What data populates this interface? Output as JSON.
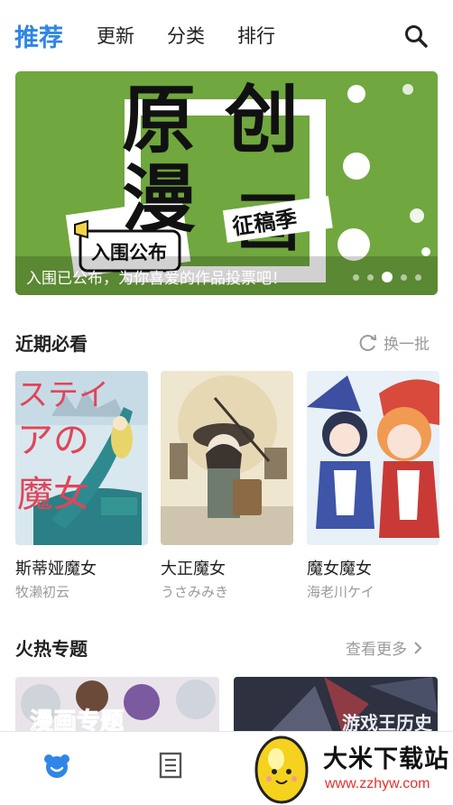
{
  "nav": {
    "tabs": [
      {
        "label": "推荐",
        "active": true
      },
      {
        "label": "更新",
        "active": false
      },
      {
        "label": "分类",
        "active": false
      },
      {
        "label": "排行",
        "active": false
      }
    ],
    "search_icon": "search-icon"
  },
  "banner": {
    "art_text": [
      "原",
      "创",
      "漫",
      "画",
      "征稿季",
      "入围公布"
    ],
    "caption": "入围已公布，为你喜爱的作品投票吧！",
    "slide_count": 5,
    "active_slide": 3
  },
  "recent": {
    "title": "近期必看",
    "action_label": "换一批",
    "action_icon": "refresh-icon",
    "items": [
      {
        "title": "斯蒂娅魔女",
        "author": "牧濑初云",
        "cover_text": [
          "ステイ",
          "アの",
          "魔女"
        ]
      },
      {
        "title": "大正魔女",
        "author": "うさみみき"
      },
      {
        "title": "魔女魔女",
        "author": "海老川ケイ"
      }
    ]
  },
  "hot": {
    "title": "火热专题",
    "action_label": "查看更多",
    "action_icon": "chevron-right-icon",
    "topics": [
      {
        "cover_text": "漫画专题"
      },
      {
        "cover_text": "游戏王历史"
      }
    ]
  },
  "tabbar": {
    "items": [
      {
        "icon": "bear-home-icon",
        "active": true
      },
      {
        "icon": "document-icon",
        "active": false
      }
    ]
  },
  "watermark": {
    "text": "大米下载站",
    "url": "www.zzhyw.com"
  },
  "colors": {
    "accent": "#2f86e6",
    "muted": "#9a9a9a",
    "banner_green": "#6aa23a",
    "watermark_red": "#e8302c"
  }
}
